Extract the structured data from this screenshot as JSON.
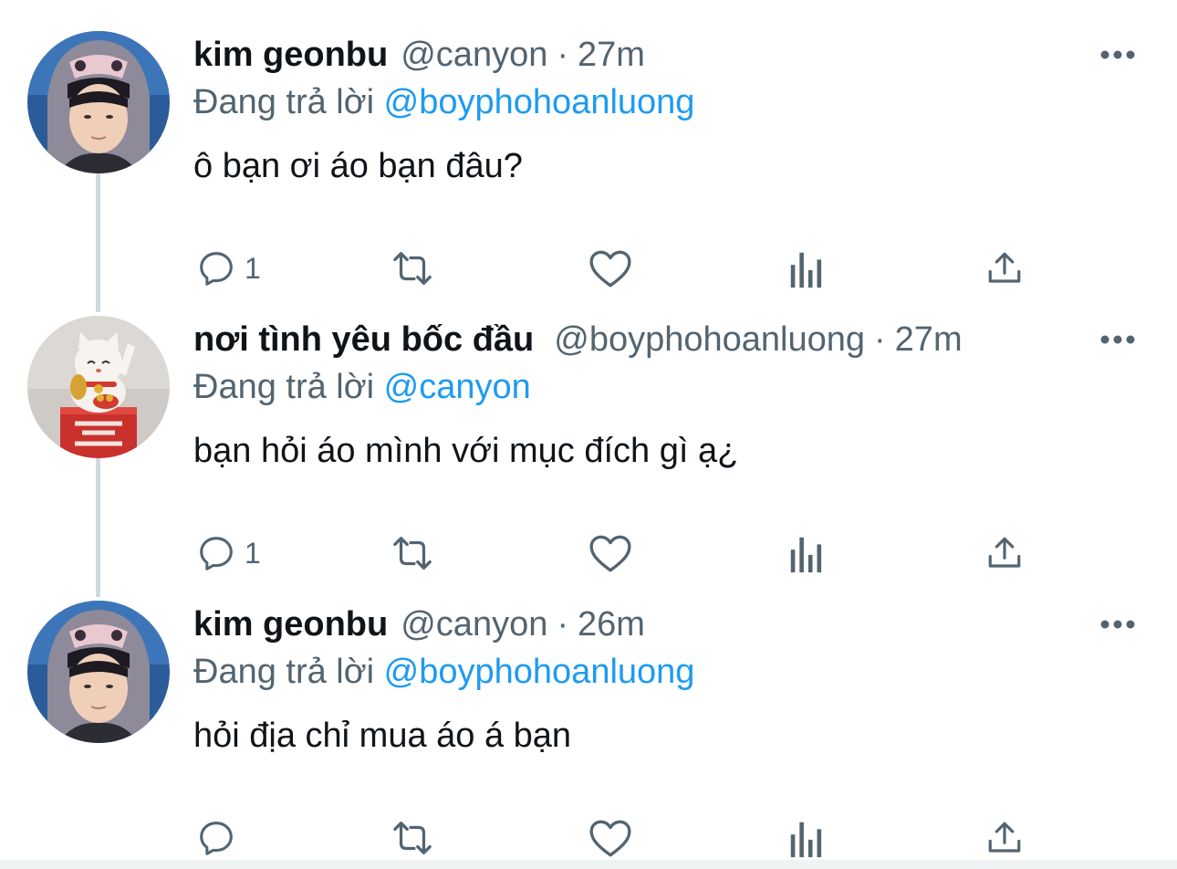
{
  "tweets": [
    {
      "name": "kim geonbu",
      "handle": "@canyon",
      "separator": "·",
      "time": "27m",
      "reply_prefix": "Đang trả lời",
      "reply_to": "@boyphohoanluong",
      "text": "ô bạn ơi áo bạn đâu?",
      "reply_count": "1",
      "avatar": "user-avatar-canyon"
    },
    {
      "name": "nơi tình yêu bốc đầu",
      "handle": "@boyphohoanluong",
      "separator": "·",
      "time": "27m",
      "reply_prefix": "Đang trả lời",
      "reply_to": "@canyon",
      "text": "bạn hỏi áo mình với mục đích gì ạ¿",
      "reply_count": "1",
      "avatar": "lucky-cat-avatar"
    },
    {
      "name": "kim geonbu",
      "handle": "@canyon",
      "separator": "·",
      "time": "26m",
      "reply_prefix": "Đang trả lời",
      "reply_to": "@boyphohoanluong",
      "text": "hỏi địa chỉ mua áo á bạn",
      "reply_count": "",
      "avatar": "user-avatar-canyon"
    }
  ],
  "icons": {
    "reply": "reply-icon",
    "retweet": "retweet-icon",
    "like": "heart-icon",
    "analytics": "analytics-icon",
    "share": "share-icon",
    "more": "more-icon"
  },
  "colors": {
    "accent": "#1d9bf0",
    "secondary_text": "#536471",
    "primary_text": "#0f1419",
    "thread_line": "#cfd9de"
  }
}
